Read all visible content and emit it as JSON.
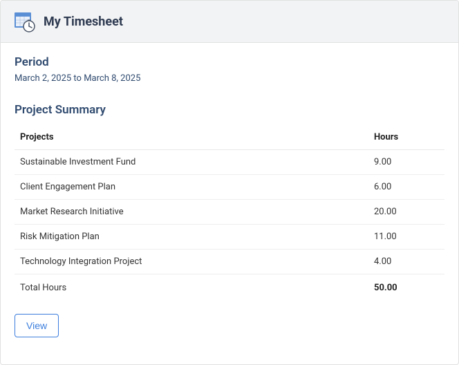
{
  "header": {
    "title": "My Timesheet"
  },
  "period": {
    "label": "Period",
    "value": "March 2, 2025 to March 8, 2025"
  },
  "summary": {
    "title": "Project Summary",
    "columns": {
      "projects": "Projects",
      "hours": "Hours"
    },
    "rows": [
      {
        "project": "Sustainable Investment Fund",
        "hours": "9.00"
      },
      {
        "project": "Client Engagement Plan",
        "hours": "6.00"
      },
      {
        "project": "Market Research Initiative",
        "hours": "20.00"
      },
      {
        "project": "Risk Mitigation Plan",
        "hours": "11.00"
      },
      {
        "project": "Technology Integration Project",
        "hours": "4.00"
      }
    ],
    "total": {
      "label": "Total Hours",
      "hours": "50.00"
    }
  },
  "actions": {
    "view_label": "View"
  }
}
